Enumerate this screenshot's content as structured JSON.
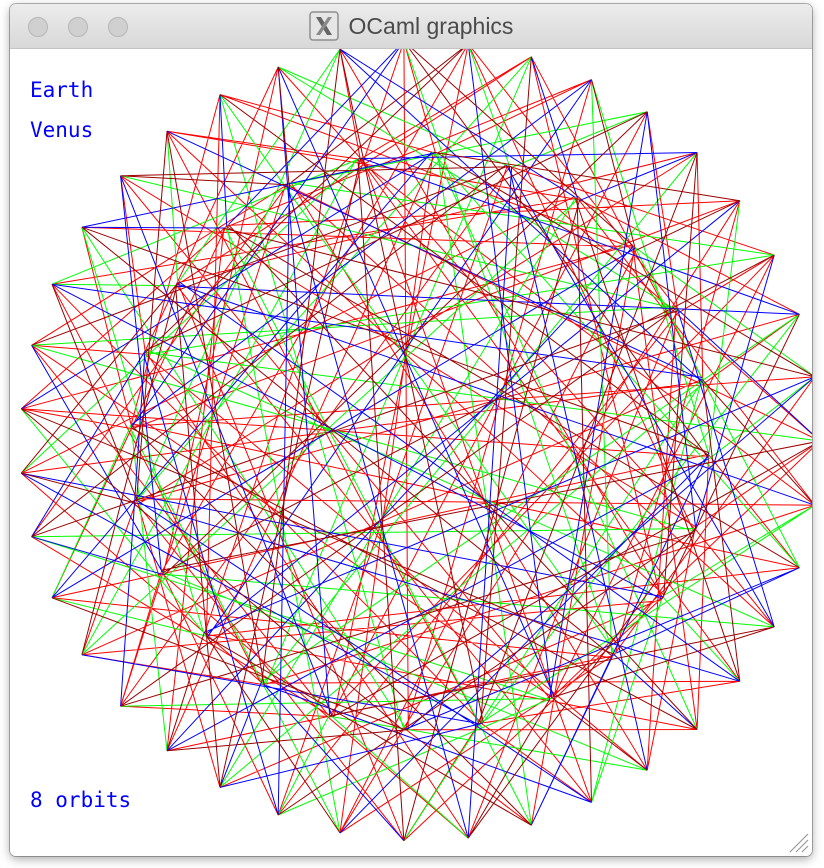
{
  "window": {
    "title": "OCaml graphics",
    "app_icon": "x11-icon",
    "controls": [
      "close-button",
      "minimize-button",
      "zoom-button"
    ]
  },
  "canvas": {
    "labels": {
      "planet_1": "Earth",
      "planet_2": "Venus",
      "orbit_count": "8 orbits"
    },
    "colors": {
      "text": "#0000ff",
      "line_red": "#ff0000",
      "line_green": "#00ff00",
      "line_blue": "#0000ff",
      "line_dark_red": "#9a0000"
    },
    "drawing": "Spirograph-style line pattern connecting Earth and Venus positions over 8 orbits"
  }
}
